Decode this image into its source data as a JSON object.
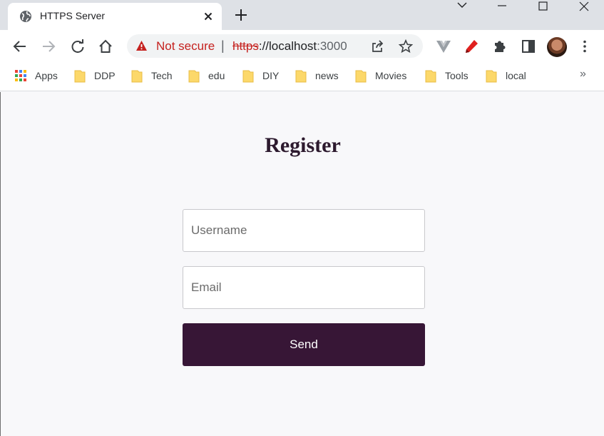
{
  "tab": {
    "title": "HTTPS Server",
    "favicon": "globe-icon"
  },
  "omnibox": {
    "security_label": "Not secure",
    "separator": "|",
    "url_scheme": "https",
    "url_host": "://localhost",
    "url_port": ":3000"
  },
  "bookmarks": {
    "apps_label": "Apps",
    "items": [
      "DDP",
      "Tech",
      "edu",
      "DIY",
      "news",
      "Movies",
      "Tools",
      "local"
    ],
    "overflow": "»"
  },
  "form": {
    "heading": "Register",
    "username_placeholder": "Username",
    "email_placeholder": "Email",
    "submit_label": "Send"
  },
  "colors": {
    "button_bg": "#371636",
    "heading": "#2d1a2e",
    "warning": "#c5221f",
    "page_bg": "#f8f8fa"
  }
}
